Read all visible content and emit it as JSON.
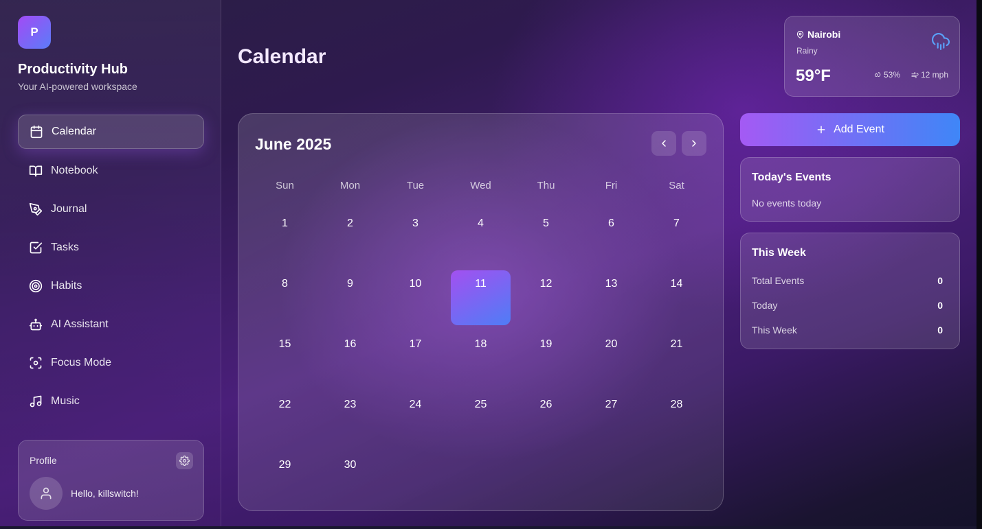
{
  "app": {
    "logo_letter": "P",
    "title": "Productivity Hub",
    "subtitle": "Your AI-powered workspace"
  },
  "sidebar": {
    "items": [
      {
        "label": "Calendar",
        "icon": "calendar-icon",
        "active": true
      },
      {
        "label": "Notebook",
        "icon": "book-open-icon",
        "active": false
      },
      {
        "label": "Journal",
        "icon": "pen-tool-icon",
        "active": false
      },
      {
        "label": "Tasks",
        "icon": "check-square-icon",
        "active": false
      },
      {
        "label": "Habits",
        "icon": "target-icon",
        "active": false
      },
      {
        "label": "AI Assistant",
        "icon": "bot-icon",
        "active": false
      },
      {
        "label": "Focus Mode",
        "icon": "focus-icon",
        "active": false
      },
      {
        "label": "Music",
        "icon": "music-icon",
        "active": false
      }
    ]
  },
  "profile": {
    "label": "Profile",
    "greeting": "Hello, killswitch!"
  },
  "page": {
    "title": "Calendar"
  },
  "weather": {
    "city": "Nairobi",
    "condition": "Rainy",
    "temperature": "59°F",
    "humidity": "53%",
    "wind": "12 mph"
  },
  "calendar": {
    "month_label": "June 2025",
    "weekdays": [
      "Sun",
      "Mon",
      "Tue",
      "Wed",
      "Thu",
      "Fri",
      "Sat"
    ],
    "days": [
      [
        "1",
        "2",
        "3",
        "4",
        "5",
        "6",
        "7"
      ],
      [
        "8",
        "9",
        "10",
        "11",
        "12",
        "13",
        "14"
      ],
      [
        "15",
        "16",
        "17",
        "18",
        "19",
        "20",
        "21"
      ],
      [
        "22",
        "23",
        "24",
        "25",
        "26",
        "27",
        "28"
      ],
      [
        "29",
        "30",
        "",
        "",
        "",
        "",
        ""
      ]
    ],
    "selected_day": "11"
  },
  "actions": {
    "add_event_label": "Add Event"
  },
  "todays_events": {
    "title": "Today's Events",
    "empty_text": "No events today"
  },
  "this_week": {
    "title": "This Week",
    "stats": [
      {
        "label": "Total Events",
        "value": "0"
      },
      {
        "label": "Today",
        "value": "0"
      },
      {
        "label": "This Week",
        "value": "0"
      }
    ]
  },
  "colors": {
    "accent_purple": "#a24bf5",
    "accent_blue": "#4f7df6",
    "weather_icon": "#5aa0f8"
  }
}
